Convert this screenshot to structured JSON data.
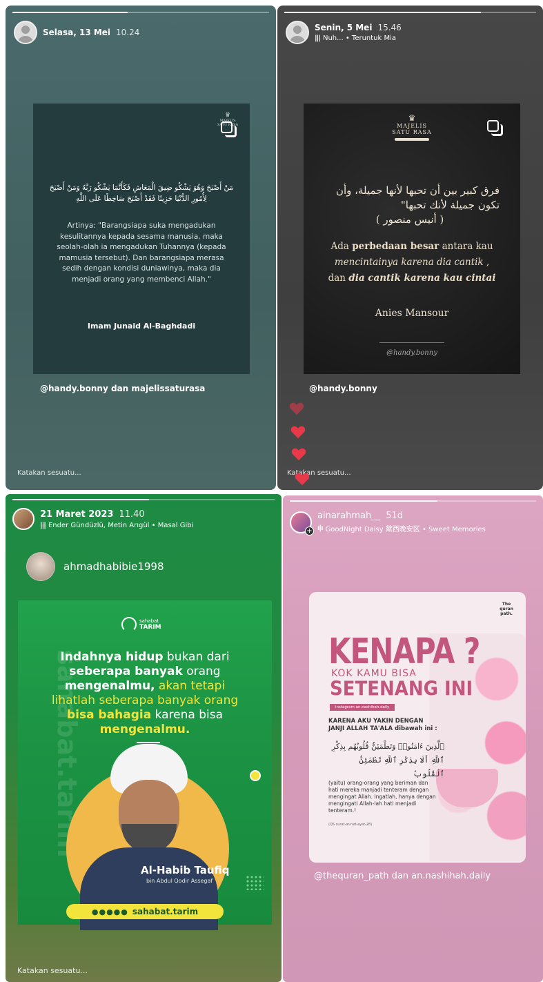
{
  "story1": {
    "date": "Selasa, 13 Mei",
    "time": "10.24",
    "arabic": "مَنْ أَصْبَحَ وَهُوَ يَشْكُو ضِيقَ الْمَعَاشِ فَكَأَنَّمَا يَشْكُو رَبَّهُ وَمَنْ أَصْبَحَ لِأُمُورِ الدُّنْيَا حَزِينًا فَقَدْ أَصْبَحَ سَاخِطًا عَلَى اللَّهِ",
    "translation": "Artinya: \"Barangsiapa suka mengadukan kesulitannya kepada sesama manusia, maka seolah-olah ia mengadukan Tuhannya (kepada mamusia tersebut). Dan barangsiapa merasa sedih dengan kondisi duniawinya, maka dia menjadi orang yang membenci Allah.\"",
    "author": "Imam Junaid Al-Baghdadi",
    "logo_line1": "MAJELIS",
    "logo_line2": "SATU RASA",
    "mention": "@handy.bonny dan majelissaturasa",
    "reply_placeholder": "Katakan sesuatu..."
  },
  "story2": {
    "date": "Senin, 5 Mei",
    "time": "15.46",
    "music": "Nuh... • Teruntuk Mia",
    "logo_line1": "MAJELIS",
    "logo_line2": "SATU RASA",
    "arabic_line1": "فرق كبير بين أن تحبها لأنها جميلة، وأن",
    "arabic_line2": "تكون جميلة لأنك تحبها\"",
    "arabic_line3": "( أنيس منصور )",
    "quote_a": "Ada ",
    "quote_b": "perbedaan besar",
    "quote_c": " antara kau",
    "quote_d": "mencintainya karena dia cantik ,",
    "quote_e": "dan ",
    "quote_f": "dia cantik karena kau cintai",
    "author": "Anies Mansour",
    "handle": "@handy.bonny",
    "mention": "@handy.bonny",
    "reply_placeholder": "Katakan sesuatu..."
  },
  "story3": {
    "date": "21 Maret 2023",
    "time": "11.40",
    "music": "Ender Gündüzlü, Metin Arıgül • Masal Gibi",
    "username": "ahmadhabibie1998",
    "brand_small": "sahabat",
    "brand_big": "TARIM",
    "watermark": "sahabat.tarim",
    "l1_a": "Indahnya hidup",
    "l1_b": " bukan dari",
    "l2": "seberapa banyak",
    "l2_b": " orang",
    "l3_a": "mengenalmu,",
    "l3_b": " akan tetapi",
    "l4_a": "lihatlah seberapa banyak orang",
    "l5_a": "bisa bahagia",
    "l5_b": " karena bisa",
    "l6": "mengenalmu.",
    "person_name": "Al-Habib Taufiq",
    "person_sub": "bin Abdul Qodir Assegaf",
    "social_handle": "sahabat.tarim",
    "reply_placeholder": "Katakan sesuatu..."
  },
  "story4": {
    "username": "ainarahmah__",
    "age": "51d",
    "music": "GoodNight Daisy 黛西晚安区 • Sweet Memories",
    "brand": "The quran path.",
    "title": "KENAPA ?",
    "sub1": "KOK KAMU BISA",
    "sub2": "SETENANG INI",
    "tag": "instagram an.nashihah.daily",
    "lead1": "KARENA AKU YAKIN DENGAN",
    "lead2": "JANJI ALLAH TA'ALA dibawah ini :",
    "arabic1": "ٱلَّذِينَ ءَامَنُوا۟ وَتَطْمَئِنُّ قُلُوبُهُم بِذِكْرِ",
    "arabic2": "ٱللَّهِ أَلَا بِذِكْرِ ٱللَّهِ تَطْمَئِنُّ ٱلْقُلُوبُ",
    "body": "(yaitu) orang-orang yang beriman dan hati mereka manjadi tenteram dengan mengingat Allah. Ingatlah, hanya dengan mengingati Allah-lah hati menjadi tenteram.!",
    "ref": "(QS surat-ar-rad-ayat-28)",
    "mention": "@thequran_path dan an.nashihah.daily"
  },
  "colors": {
    "panel1": "#4a6a6c",
    "panel2": "#444444",
    "panel3": "#1d8a44",
    "panel4": "#d69ab9",
    "heart": "#e8394a",
    "kenapa": "#c2567d",
    "yellow": "#f2e43a"
  }
}
